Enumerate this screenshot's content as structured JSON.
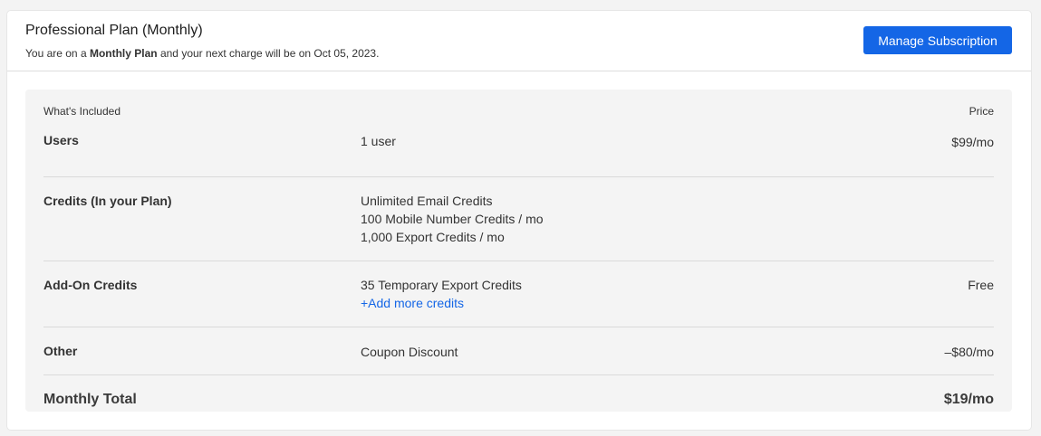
{
  "plan": {
    "title": "Professional Plan (Monthly)",
    "subtitle_prefix": "You are on a ",
    "subtitle_bold": "Monthly Plan",
    "subtitle_suffix": " and your next charge will be on Oct 05, 2023.",
    "manage_button": "Manage Subscription"
  },
  "table": {
    "header_included": "What's Included",
    "header_price": "Price",
    "rows": [
      {
        "label": "Users",
        "details": [
          "1 user"
        ],
        "price": "$99/mo"
      },
      {
        "label": "Credits (In your Plan)",
        "details": [
          "Unlimited Email Credits",
          "100 Mobile Number Credits / mo",
          "1,000 Export Credits / mo"
        ],
        "price": ""
      },
      {
        "label": "Add-On Credits",
        "details": [
          "35 Temporary Export Credits"
        ],
        "link": "+Add more credits",
        "price": "Free"
      },
      {
        "label": "Other",
        "details": [
          "Coupon Discount"
        ],
        "price": "–$80/mo"
      }
    ],
    "total_label": "Monthly Total",
    "total_price": "$19/mo"
  },
  "colors": {
    "accent": "#1466e6",
    "panel_background": "#f4f4f4",
    "page_background": "#f3f3f3"
  }
}
